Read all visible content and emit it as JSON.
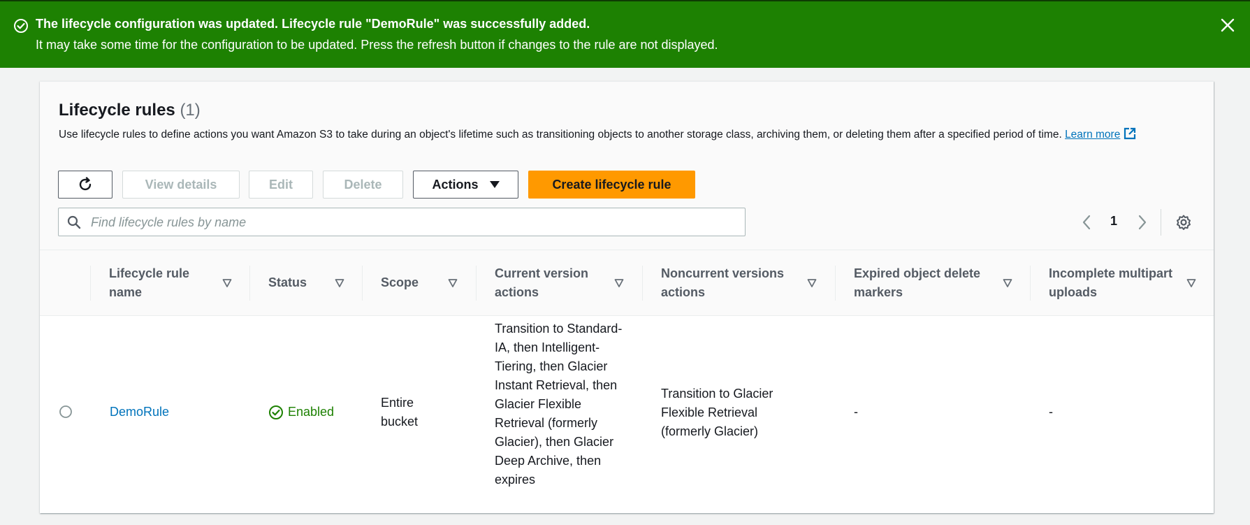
{
  "flash": {
    "title": "The lifecycle configuration was updated. Lifecycle rule \"DemoRule\" was successfully added.",
    "message": "It may take some time for the configuration to be updated. Press the refresh button if changes to the rule are not displayed.",
    "icon": "success-check-icon",
    "bg_color": "#1d8102"
  },
  "panel": {
    "title": "Lifecycle rules",
    "count": "(1)",
    "description": "Use lifecycle rules to define actions you want Amazon S3 to take during an object's lifetime such as transitioning objects to another storage class, archiving them, or deleting them after a specified period of time.",
    "learn_more": "Learn more"
  },
  "toolbar": {
    "view_details": "View details",
    "edit": "Edit",
    "delete": "Delete",
    "actions": "Actions",
    "create": "Create lifecycle rule"
  },
  "search": {
    "placeholder": "Find lifecycle rules by name",
    "value": ""
  },
  "pagination": {
    "current_page": "1"
  },
  "table": {
    "columns": [
      "Lifecycle rule name",
      "Status",
      "Scope",
      "Current version actions",
      "Noncurrent versions actions",
      "Expired object delete markers",
      "Incomplete multipart uploads"
    ],
    "rows": [
      {
        "name": "DemoRule",
        "status": "Enabled",
        "scope": "Entire bucket",
        "current_actions": "Transition to Standard-IA, then Intelligent-Tiering, then Glacier Instant Retrieval, then Glacier Flexible Retrieval (formerly Glacier), then Glacier Deep Archive, then expires",
        "noncurrent_actions": "Transition to Glacier Flexible Retrieval (formerly Glacier)",
        "expired_markers": "-",
        "incomplete_uploads": "-"
      }
    ]
  },
  "colors": {
    "primary_button": "#ff9900",
    "link": "#0073bb",
    "success": "#1d8102"
  }
}
